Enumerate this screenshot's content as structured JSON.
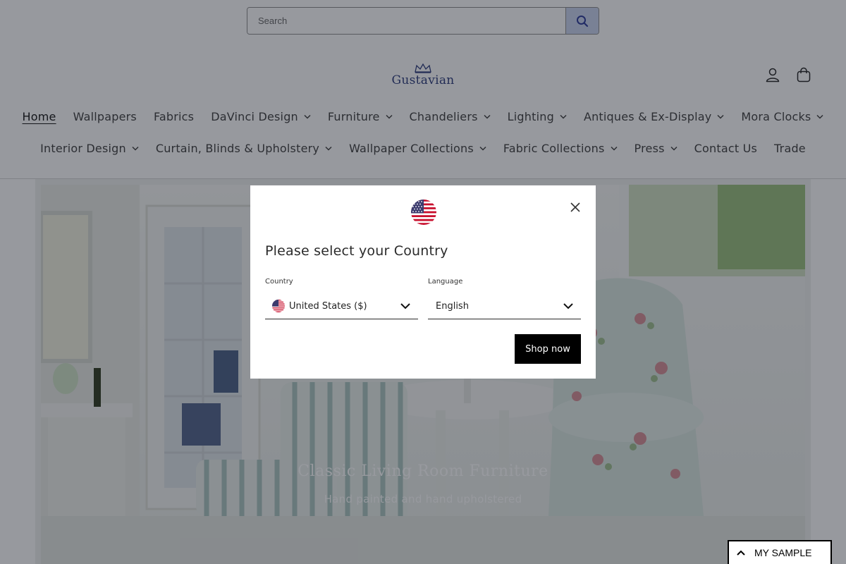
{
  "search": {
    "placeholder": "Search"
  },
  "brand": {
    "name": "Gustavian"
  },
  "nav": {
    "row1": [
      {
        "label": "Home",
        "active": true,
        "dropdown": false
      },
      {
        "label": "Wallpapers",
        "dropdown": false
      },
      {
        "label": "Fabrics",
        "dropdown": false
      },
      {
        "label": "DaVinci Design",
        "dropdown": true
      },
      {
        "label": "Furniture",
        "dropdown": true
      },
      {
        "label": "Chandeliers",
        "dropdown": true
      },
      {
        "label": "Lighting",
        "dropdown": true
      },
      {
        "label": "Antiques & Ex-Display",
        "dropdown": true
      },
      {
        "label": "Mora Clocks",
        "dropdown": true
      }
    ],
    "row2": [
      {
        "label": "Interior Design",
        "dropdown": true
      },
      {
        "label": "Curtain, Blinds & Upholstery",
        "dropdown": true
      },
      {
        "label": "Wallpaper Collections",
        "dropdown": true
      },
      {
        "label": "Fabric Collections",
        "dropdown": true
      },
      {
        "label": "Press",
        "dropdown": true
      },
      {
        "label": "Contact Us",
        "dropdown": false
      },
      {
        "label": "Trade",
        "dropdown": false
      }
    ]
  },
  "hero": {
    "title": "Classic Living Room Furniture",
    "subtitle": "Hand painted and hand upholstered"
  },
  "modal": {
    "title": "Please select your Country",
    "country_label": "Country",
    "country_value": "United States ($)",
    "language_label": "Language",
    "language_value": "English",
    "submit_label": "Shop now",
    "flag_icon": "us-flag-icon"
  },
  "sample_tab": {
    "label": "MY SAMPLE"
  },
  "colors": {
    "overlay": "rgba(24,28,40,0.45)",
    "brand": "#2a3a7a",
    "search_button": "#c9d3ee",
    "button_dark": "#000000"
  }
}
